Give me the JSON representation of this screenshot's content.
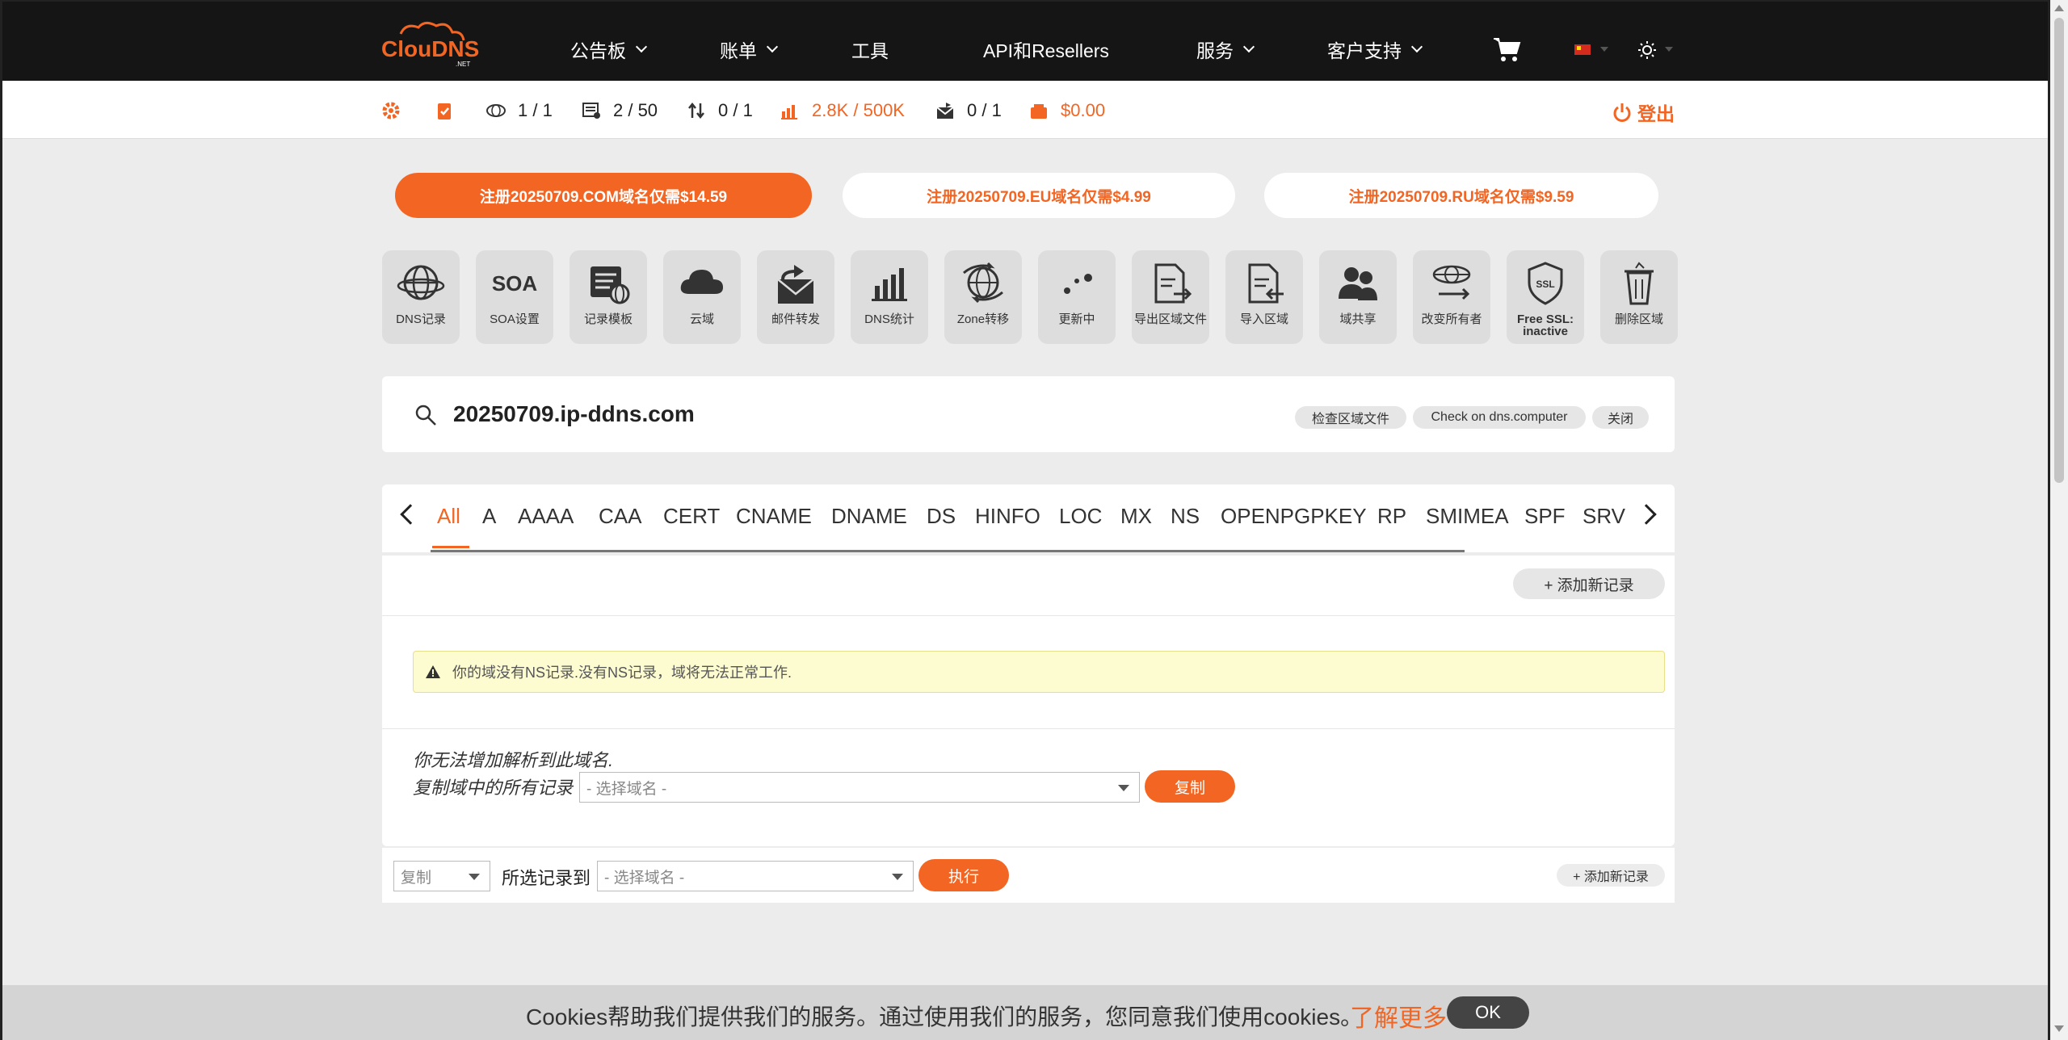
{
  "brand": {
    "logo_text": "ClouDNS",
    "logo_sub": ".NET",
    "accent": "#f26522"
  },
  "nav": {
    "items": [
      {
        "label": "公告板",
        "dropdown": true
      },
      {
        "label": "账单",
        "dropdown": true
      },
      {
        "label": "工具",
        "dropdown": false
      },
      {
        "label": "API和Resellers",
        "dropdown": false
      },
      {
        "label": "服务",
        "dropdown": true
      },
      {
        "label": "客户支持",
        "dropdown": true
      }
    ],
    "cart_icon": "cart-icon",
    "language_icon": "flag-cn-icon",
    "theme_icon": "sun-icon"
  },
  "stats": {
    "zones": "1 / 1",
    "records": "2 / 50",
    "transfers": "0 / 1",
    "queries": "2.8K / 500K",
    "mail": "0 / 1",
    "balance": "$0.00",
    "logout": "登出"
  },
  "promos": [
    {
      "label": "注册20250709.COM域名仅需$14.59",
      "style": "primary"
    },
    {
      "label": "注册20250709.EU域名仅需$4.99",
      "style": "secondary"
    },
    {
      "label": "注册20250709.RU域名仅需$9.59",
      "style": "secondary"
    }
  ],
  "tools": [
    {
      "label": "DNS记录",
      "icon": "globe-icon"
    },
    {
      "label": "SOA设置",
      "icon": "soa-icon"
    },
    {
      "label": "记录模板",
      "icon": "template-icon"
    },
    {
      "label": "云域",
      "icon": "cloud-icon"
    },
    {
      "label": "邮件转发",
      "icon": "mail-forward-icon"
    },
    {
      "label": "DNS统计",
      "icon": "bar-chart-icon"
    },
    {
      "label": "Zone转移",
      "icon": "globe-transfer-icon"
    },
    {
      "label": "更新中",
      "icon": "loading-dots-icon"
    },
    {
      "label": "导出区域文件",
      "icon": "export-file-icon"
    },
    {
      "label": "导入区域",
      "icon": "import-file-icon"
    },
    {
      "label": "域共享",
      "icon": "users-icon"
    },
    {
      "label": "改变所有者",
      "icon": "change-owner-icon"
    },
    {
      "label": "Free SSL: inactive",
      "icon": "ssl-shield-icon"
    },
    {
      "label": "删除区域",
      "icon": "trash-icon"
    }
  ],
  "domain": {
    "name": "20250709.ip-ddns.com",
    "actions": [
      "检查区域文件",
      "Check on dns.computer",
      "关闭"
    ]
  },
  "record_tabs": [
    "All",
    "A",
    "AAAA",
    "CAA",
    "CERT",
    "CNAME",
    "DNAME",
    "DS",
    "HINFO",
    "LOC",
    "MX",
    "NS",
    "OPENPGPKEY",
    "RP",
    "SMIMEA",
    "SPF",
    "SRV"
  ],
  "main": {
    "add_record": "+ 添加新记录",
    "warning": "你的域没有NS记录.没有NS记录，域将无法正常工作.",
    "cannot_add": "你无法增加解析到此域名.",
    "copy_all_label": "复制域中的所有记录",
    "select_domain_placeholder": "- 选择域名 -",
    "copy_button": "复制"
  },
  "action_row": {
    "action_select": "复制",
    "selected_to": "所选记录到",
    "domain_placeholder": "- 选择域名 -",
    "execute": "执行",
    "add_record": "+ 添加新记录"
  },
  "cookie": {
    "text": "Cookies帮助我们提供我们的服务。通过使用我们的服务，您同意我们使用cookies。",
    "link": "了解更多",
    "ok": "OK"
  }
}
